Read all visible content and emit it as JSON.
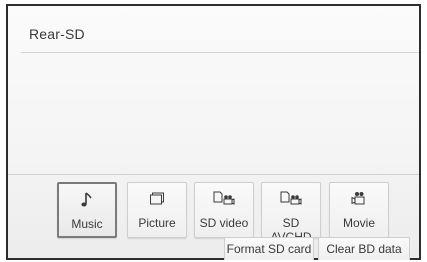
{
  "screen": {
    "title": "Rear-SD"
  },
  "sources": [
    {
      "label": "Music",
      "icon": "music-note-icon",
      "selected": true
    },
    {
      "label": "Picture",
      "icon": "picture-icon",
      "selected": false
    },
    {
      "label": "SD video",
      "icon": "sd-video-icon",
      "selected": false
    },
    {
      "label": "SD AVCHD",
      "icon": "sd-avchd-icon",
      "selected": false
    },
    {
      "label": "Movie",
      "icon": "movie-icon",
      "selected": false
    }
  ],
  "actions": {
    "format_sd": "Format SD card",
    "clear_bd": "Clear BD data"
  },
  "colors": {
    "frame": "#2d2d2d",
    "text": "#3a3a3a",
    "selected_border": "#7b7b7b"
  }
}
